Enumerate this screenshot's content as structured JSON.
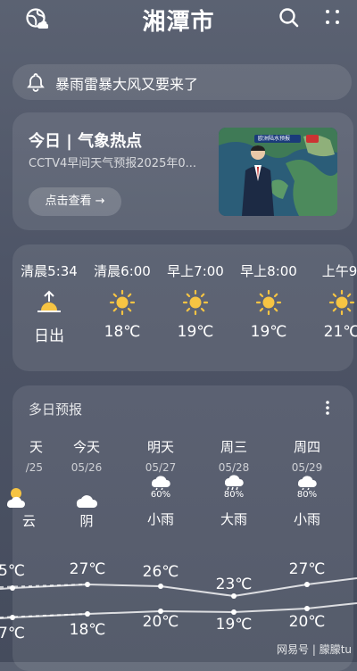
{
  "header": {
    "city": "湘潭市"
  },
  "alert": {
    "text": "暴雨雷暴大风又要来了"
  },
  "hot": {
    "title": "今日 | 气象热点",
    "subtitle": "CCTV4早间天气预报2025年0...",
    "button": "点击查看 →",
    "thumb_caption": "欧洲陆水预报"
  },
  "hourly": [
    {
      "time": "清晨5:34",
      "icon": "sunrise-icon",
      "value": "日出"
    },
    {
      "time": "清晨6:00",
      "icon": "sun-icon",
      "value": "18℃"
    },
    {
      "time": "早上7:00",
      "icon": "sun-icon",
      "value": "19℃"
    },
    {
      "time": "早上8:00",
      "icon": "sun-icon",
      "value": "19℃"
    },
    {
      "time": "上午9:",
      "icon": "sun-icon",
      "value": "21℃"
    }
  ],
  "daily": {
    "title": "多日预报",
    "days": [
      {
        "name": "天",
        "date": "/25",
        "precip": "",
        "icon": "partly-cloudy-icon",
        "cond": "云",
        "high": "5℃",
        "low": "7℃"
      },
      {
        "name": "今天",
        "date": "05/26",
        "precip": "",
        "icon": "cloud-icon",
        "cond": "阴",
        "high": "27℃",
        "low": "18℃"
      },
      {
        "name": "明天",
        "date": "05/27",
        "precip": "60%",
        "icon": "rain-icon",
        "cond": "小雨",
        "high": "26℃",
        "low": "20℃"
      },
      {
        "name": "周三",
        "date": "05/28",
        "precip": "80%",
        "icon": "heavy-rain-icon",
        "cond": "大雨",
        "high": "23℃",
        "low": "19℃"
      },
      {
        "name": "周四",
        "date": "05/29",
        "precip": "80%",
        "icon": "rain-icon",
        "cond": "小雨",
        "high": "27℃",
        "low": "20℃"
      }
    ]
  },
  "watermark": "网易号 | 朦朦tu"
}
